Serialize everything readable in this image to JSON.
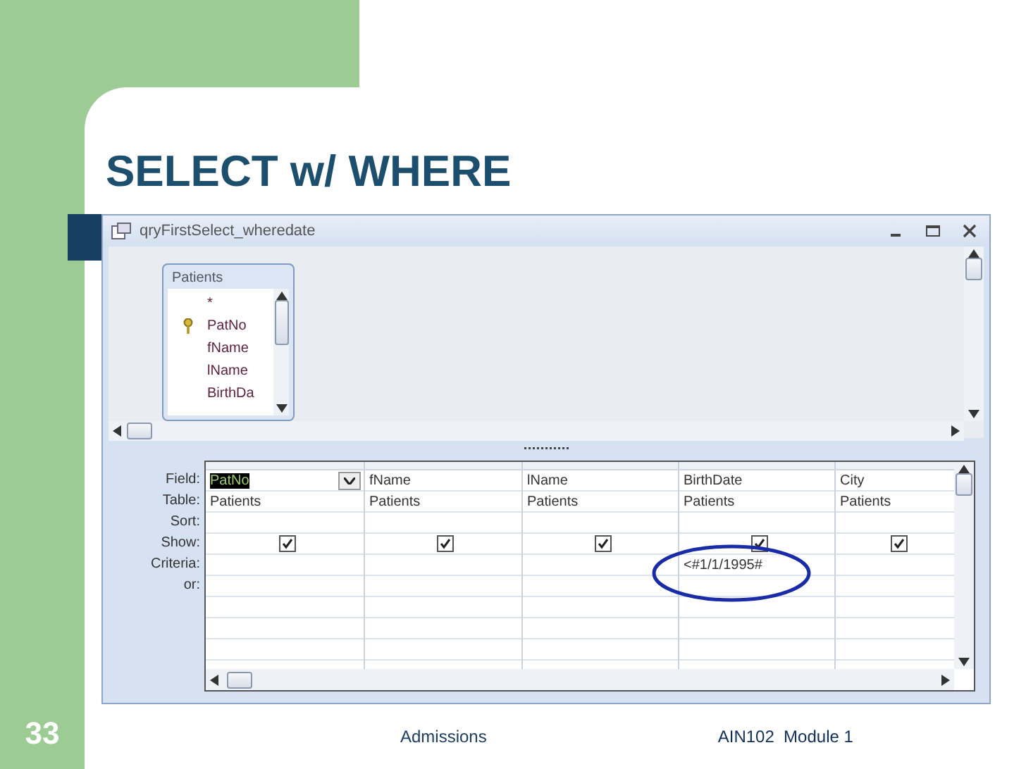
{
  "slide": {
    "title": "SELECT w/ WHERE",
    "number": "33",
    "footer_center": "Admissions",
    "footer_right": "AIN102  Module 1"
  },
  "window": {
    "title": "qryFirstSelect_wheredate"
  },
  "table_box": {
    "title": "Patients",
    "fields": [
      {
        "name": "*",
        "key": false
      },
      {
        "name": "PatNo",
        "key": true
      },
      {
        "name": "fName",
        "key": false
      },
      {
        "name": "lName",
        "key": false
      },
      {
        "name": "BirthDa",
        "key": false
      }
    ]
  },
  "grid": {
    "row_labels": [
      "Field:",
      "Table:",
      "Sort:",
      "Show:",
      "Criteria:",
      "or:"
    ],
    "columns": [
      {
        "field": "PatNo",
        "table": "Patients",
        "show": true,
        "selected": true,
        "circled": false
      },
      {
        "field": "fName",
        "table": "Patients",
        "show": true,
        "selected": false,
        "circled": false
      },
      {
        "field": "lName",
        "table": "Patients",
        "show": true,
        "selected": false,
        "circled": false
      },
      {
        "field": "BirthDate",
        "table": "Patients",
        "show": true,
        "criteria": "<#1/1/1995#",
        "selected": false,
        "circled": true
      },
      {
        "field": "City",
        "table": "Patients",
        "show": true,
        "selected": false,
        "circled": false
      }
    ]
  }
}
